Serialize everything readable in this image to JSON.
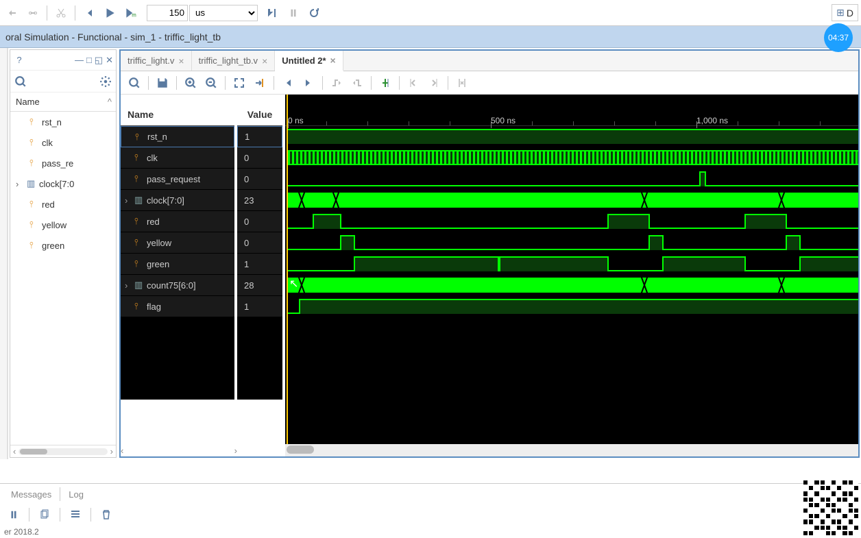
{
  "toolbar": {
    "run_time_value": "150",
    "run_time_unit": "us"
  },
  "title": "oral Simulation - Functional - sim_1 - triffic_light_tb",
  "badge": "04:37",
  "d_label": "D",
  "scope": {
    "header_name": "Name",
    "items": [
      {
        "name": "rst_n",
        "type": "sig"
      },
      {
        "name": "clk",
        "type": "sig"
      },
      {
        "name": "pass_re",
        "type": "sig"
      },
      {
        "name": "clock[7:0",
        "type": "bus",
        "expandable": true
      },
      {
        "name": "red",
        "type": "sig"
      },
      {
        "name": "yellow",
        "type": "sig"
      },
      {
        "name": "green",
        "type": "sig"
      }
    ]
  },
  "tabs": [
    {
      "label": "triffic_light.v",
      "active": false
    },
    {
      "label": "triffic_light_tb.v",
      "active": false
    },
    {
      "label": "Untitled 2*",
      "active": true
    }
  ],
  "wave": {
    "name_header": "Name",
    "value_header": "Value",
    "signals": [
      {
        "name": "rst_n",
        "value": "1",
        "selected": true,
        "type": "sig"
      },
      {
        "name": "clk",
        "value": "0",
        "type": "sig"
      },
      {
        "name": "pass_request",
        "value": "0",
        "type": "sig"
      },
      {
        "name": "clock[7:0]",
        "value": "23",
        "type": "bus",
        "expandable": true
      },
      {
        "name": "red",
        "value": "0",
        "type": "sig"
      },
      {
        "name": "yellow",
        "value": "0",
        "type": "sig"
      },
      {
        "name": "green",
        "value": "1",
        "type": "sig"
      },
      {
        "name": "count75[6:0]",
        "value": "28",
        "type": "bus",
        "expandable": true
      },
      {
        "name": "flag",
        "value": "1",
        "type": "sig"
      }
    ],
    "ruler_ticks": [
      "0 ns",
      "500 ns",
      "1,000 ns"
    ]
  },
  "footer": {
    "tab_messages": "Messages",
    "tab_log": "Log",
    "version": "er 2018.2"
  }
}
